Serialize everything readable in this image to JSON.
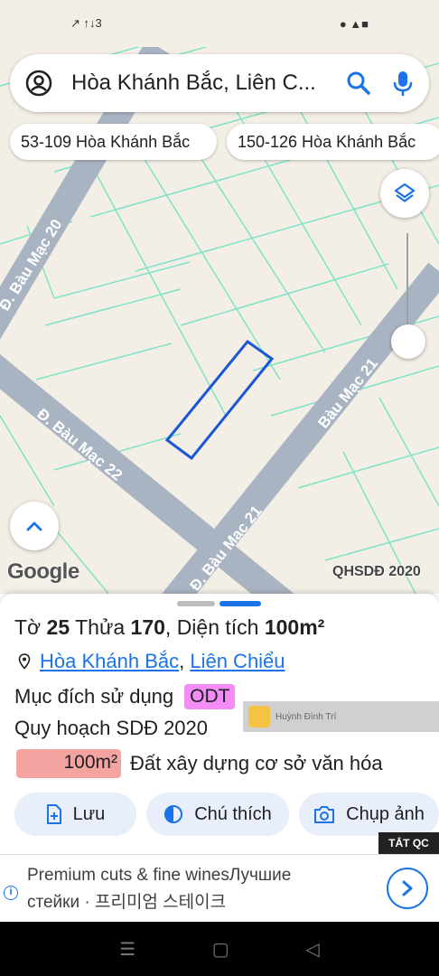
{
  "status_bar": {
    "left_text": "↗ ↑↓3",
    "right_text": "● ▲■"
  },
  "search": {
    "text": "Hòa Khánh Bắc, Liên C..."
  },
  "chips": [
    {
      "label": "53-109 Hòa Khánh Bắc"
    },
    {
      "label": "150-126 Hòa Khánh Bắc"
    }
  ],
  "map": {
    "streets": [
      "Đ. Bàu Mạc 20",
      "Đ. Bàu Mạc 22",
      "Bàu Mạc 21",
      "Đ. Bàu Mạc 21"
    ],
    "logo": "Google",
    "overlay_label": "QHSDĐ 2020",
    "colors": {
      "background": "#f3efe7",
      "road": "#a9b4c3",
      "parcel_lines": "#7fe3c8",
      "selected_parcel": "#1a56d6"
    }
  },
  "sheet": {
    "to_label": "Tờ",
    "to_value": "25",
    "thua_label": "Thửa",
    "thua_value": "170",
    "area_label": "Diện tích",
    "area_value": "100m²",
    "ward": "Hòa Khánh Bắc",
    "district": "Liên Chiểu",
    "purpose_label": "Mục đích sử dụng",
    "purpose_code": "ODT",
    "plan_label": "Quy hoạch SDĐ 2020",
    "plan_area": "100m²",
    "plan_zone": "Đất xây dựng cơ sở văn hóa"
  },
  "watermark": {
    "name": "Huỳnh Đình Trí"
  },
  "actions": {
    "save": "Lưu",
    "legend": "Chú thích",
    "photo": "Chụp ảnh"
  },
  "ad": {
    "close_label": "TẮT QC",
    "line1": "Premium cuts & fine winesЛучшие",
    "line2": "стейки · 프리미엄 스테이크"
  }
}
